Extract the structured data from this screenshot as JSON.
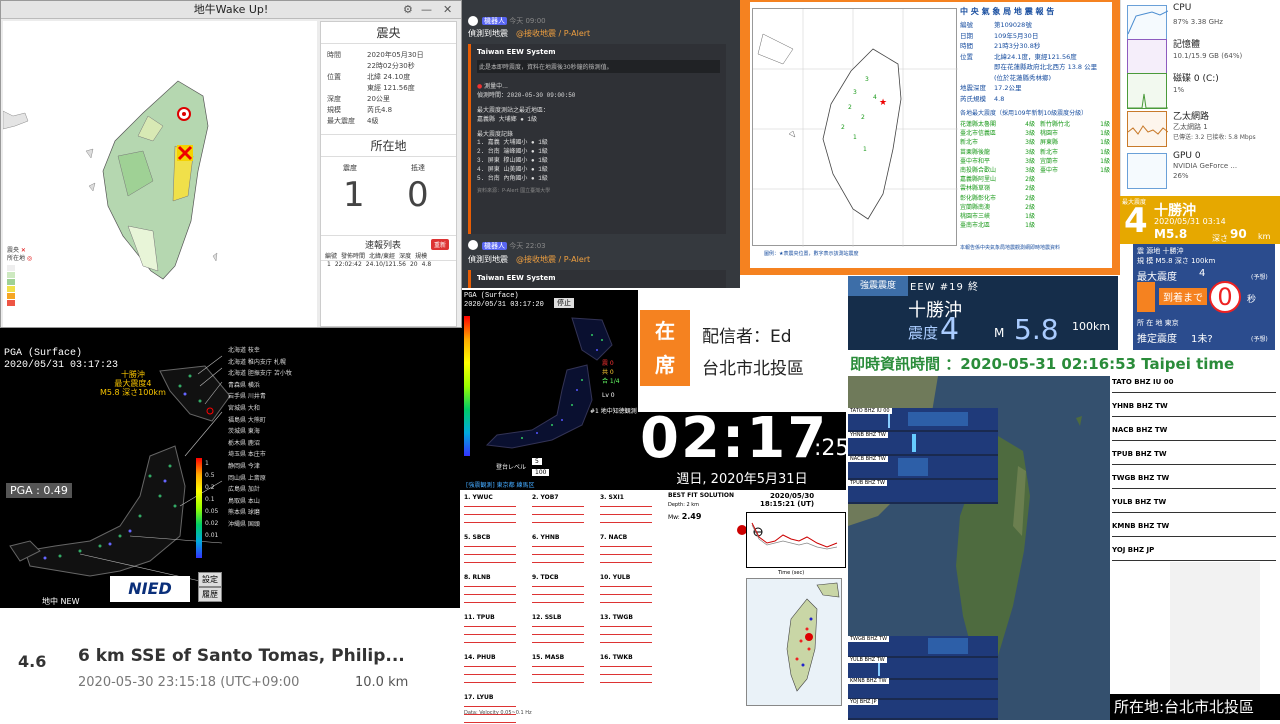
{
  "wakeup": {
    "title": "地牛Wake Up!",
    "epicenter_title": "震央",
    "rows": [
      {
        "k": "時間",
        "v": "2020年05月30日"
      },
      {
        "k": "",
        "v": "22時02分30秒"
      },
      {
        "k": "位置",
        "v": "北緯 24.10度"
      },
      {
        "k": "",
        "v": "東經 121.56度"
      },
      {
        "k": "深度",
        "v": "20公里"
      },
      {
        "k": "規模",
        "v": "芮氏4.8"
      },
      {
        "k": "最大震度",
        "v": "4級"
      }
    ],
    "location_title": "所在地",
    "intensity_label": "震度",
    "arrival_label": "抵達",
    "intensity_value": "1",
    "arrival_value": "0",
    "list_title": "速報列表",
    "list_btn": "重新",
    "table_headers": [
      "編號",
      "發佈時間",
      "北緯/東經",
      "深度",
      "規模"
    ],
    "table_row": [
      "1",
      "22:02:42",
      "24.10/121.56",
      "20",
      "4.8"
    ],
    "legend": [
      "震央",
      "所在地",
      "",
      "",
      "",
      "",
      "",
      ""
    ]
  },
  "pga": {
    "title": "PGA (Surface)",
    "time": "2020/05/31 03:17:23",
    "pga_label": "PGA : 0.49",
    "quake_line1": "十勝沖",
    "quake_line2": "最大震度4",
    "quake_line3": "M5.8 深さ100km",
    "station": "地中 NEW",
    "nied": "NIED",
    "btn_settings": "設定",
    "btn_history": "履歴",
    "scale_vals": [
      "1",
      "0.5",
      "0.2",
      "0.1",
      "0.05",
      "0.02",
      "0.01"
    ],
    "stations": [
      "北海道 枝幸",
      "北海道 稚内支庁 札幌",
      "北海道 胆振支庁 苫小牧",
      "青森県 横浜",
      "岩手県 川井青",
      "宮城県 大和",
      "福島県 大熊町",
      "茨城県 東海",
      "栃木県 鹿沼",
      "埼玉県 本庄市",
      "静岡県 今津",
      "岡山県 上斎原",
      "広島県 加計",
      "鳥取県 本山",
      "熊本県 球磨",
      "沖縄県 国頭"
    ]
  },
  "usgs": {
    "mag": "4.6",
    "title": "6 km SSE of Santo Tomas, Philip...",
    "time": "2020-05-30 23:15:18 (UTC+09:00",
    "depth": "10.0 km"
  },
  "chat": {
    "user": "機器人",
    "time1": "今天 09:00",
    "tag": "@接收地震 / P-Alert",
    "msg": "偵測到地震",
    "embed_title": "Taiwan EEW System",
    "embed_desc": "此是本即時震度，資料在地震後30秒鐘的檢測值。",
    "status": "測量中...",
    "detect_time": "偵測時間：2020-05-30 09:00:50",
    "max_station_title": "最大震度測站之最近地區：",
    "max_station": "嘉義縣 大埔鄉 ● 1級",
    "records_title": "最大震度記錄",
    "records": [
      "1. 嘉義 大埔國小 ● 1級",
      "2. 台南 端峰國小 ● 1級",
      "3. 屏東 穆山國小 ● 1級",
      "4. 屏東 山美國小 ● 1級",
      "5. 台南 內角國小 ● 1級"
    ],
    "footer": "資料來源：P-Alert 國立臺灣大學",
    "time2": "今天 22:03",
    "msg2": "偵測到地震"
  },
  "report": {
    "title": "中 央 氣 象 局 地 震 報 告",
    "rows": [
      {
        "k": "編號",
        "v": "第109028號"
      },
      {
        "k": "日期",
        "v": "109年5月30日"
      },
      {
        "k": "時間",
        "v": "21時3分30.8秒"
      },
      {
        "k": "位置",
        "v": "北緯24.1度，東經121.56度"
      },
      {
        "k": "",
        "v": "即在花蓮縣政府北北西方 13.8 公里"
      },
      {
        "k": "",
        "v": "(位於花蓮縣秀林鄉)"
      },
      {
        "k": "地震深度",
        "v": "17.2公里"
      },
      {
        "k": "芮氏規模",
        "v": "4.8"
      }
    ],
    "table_title": "各地最大震度（採用109年新制10級震度分級）",
    "cols": [
      [
        "花蓮縣太魯閣",
        "4級"
      ],
      [
        "臺北市信義區",
        "3級"
      ],
      [
        "新北市",
        "3級"
      ],
      [
        "苗栗縣後龍",
        "3級"
      ],
      [
        "臺中市和平",
        "3級"
      ],
      [
        "南投縣合歡山",
        "3級"
      ],
      [
        "嘉義縣阿里山",
        "2級"
      ],
      [
        "雲林縣草嶺",
        "2級"
      ],
      [
        "彰化縣彰化市",
        "2級"
      ],
      [
        "宜蘭縣南澳",
        "2級"
      ],
      [
        "桃園市三峽",
        "1級"
      ],
      [
        "臺南市北區",
        "1級"
      ]
    ],
    "cols2": [
      [
        "新竹縣竹北",
        "1級"
      ],
      [
        "桃園市",
        "1級"
      ],
      [
        "屏東縣",
        "1級"
      ],
      [
        "新北市",
        "1級"
      ],
      [
        "宜蘭市",
        "1級"
      ],
      [
        "臺中市",
        "1級"
      ]
    ],
    "footer": "本報告係中央氣象局地震觀測網即時地震資料",
    "legend": "圖例：★表震央位置，數字表示該測站震度"
  },
  "taskmgr": [
    {
      "name": "CPU",
      "sub": "87%  3.38 GHz"
    },
    {
      "name": "記憶體",
      "sub": "10.1/15.9 GB (64%)"
    },
    {
      "name": "磁碟 0 (C:)",
      "sub": "1%"
    },
    {
      "name": "乙太網路",
      "sub": "乙太網路 1"
    },
    {
      "name": "",
      "sub": "已傳送: 3.2  已接收: 5.8 Mbps"
    },
    {
      "name": "GPU 0",
      "sub": "NVIDIA GeForce ..."
    },
    {
      "name": "",
      "sub": "26%"
    }
  ],
  "tokachi": {
    "label": "最大震度",
    "shindo": "4",
    "name": "十勝沖",
    "datetime": "2020/05/31  03:14",
    "mag": "M5.8",
    "depth_label": "深さ",
    "depth": "90",
    "depth_unit": "km"
  },
  "eewbox": {
    "line1": "震 源地 十勝沖",
    "line2": "規 模 M5.8 深さ 100km",
    "max_label": "最大震度",
    "max_val": "4",
    "max_note": "(予想)",
    "arrive_label": "到着まで",
    "arrive_val": "0",
    "arrive_unit": "秒",
    "loc_label": "所 在 地 東京",
    "est_label": "推定震度",
    "est_val": "1未?",
    "est_note": "(予想)"
  },
  "jp": {
    "title": "PGA (Surface)",
    "time": "2020/05/31 03:17:20",
    "btn": "停止",
    "lv": "Lv 0",
    "kyo1": "震 0",
    "kyo2": "共 0",
    "kyo3": "合 1/4",
    "label1": "#1 地中知徳観測",
    "level_label": "登台レベル",
    "sel1": "5",
    "sel2": "100",
    "footer": "[強震観測] 東京都 練馬区"
  },
  "presence": {
    "zai": "在",
    "xi": "席",
    "line1": "配信者：Ed",
    "line2": "台北市北投區"
  },
  "clock": {
    "hm": "02:17",
    "sec": ":25",
    "date": "週日, 2020年5月31日"
  },
  "eew2": {
    "tag1": "強震震度",
    "tag2": "EEW #19 終",
    "name": "十勝沖",
    "shindo_label": "震度",
    "shindo": "4",
    "mag_label": "M",
    "mag": "5.8",
    "depth": "100km"
  },
  "realtime": {
    "text": "即時資訊時間 ：2020-05-31 02:16:53 Taipei time"
  },
  "spectro": {
    "labels": [
      "TATO BHZ IU 00",
      "YHNB BHZ TW",
      "NACB BHZ TW",
      "TPUB BHZ TW",
      "YULB BHZ TW",
      "KMNB BHZ TW",
      "YOJ BHZ JP"
    ],
    "bottom": [
      "TWGB BHZ TW",
      "YULB BHZ TW",
      "KMNB BHZ TW",
      "YOJ BHZ JP"
    ]
  },
  "seisright": {
    "labels": [
      "TATO BHZ IU 00",
      "YHNB BHZ TW",
      "NACB BHZ TW",
      "TPUB BHZ TW",
      "TWGB BHZ TW",
      "YULB BHZ TW",
      "KMNB BHZ TW",
      "YOJ BHZ JP"
    ]
  },
  "loc": {
    "text": "所在地:台北市北投區"
  },
  "waveform": {
    "stations": [
      "1. YWUC",
      "2. YOB7",
      "3. SXI1",
      "5. SBCB",
      "6. YHNB",
      "7. NACB",
      "8. RLNB",
      "9. TDCB",
      "10. YULB",
      "11. TPUB",
      "12. SSLB",
      "13. TWGB",
      "14. PHUB",
      "15. MASB",
      "16. TWKB",
      "17. LYUB"
    ],
    "title": "BEST FIT SOLUTION",
    "date": "2020/05/30",
    "time": "18:15:21 (UT)",
    "mw": "Mw:",
    "mw_val": "2.49",
    "depth": "Depth: 2 km",
    "yaxis": "Misfit reduction (%)",
    "xaxis": "Time (sec)",
    "footer": "Data: Velocity 0.05~0.1 Hz"
  }
}
